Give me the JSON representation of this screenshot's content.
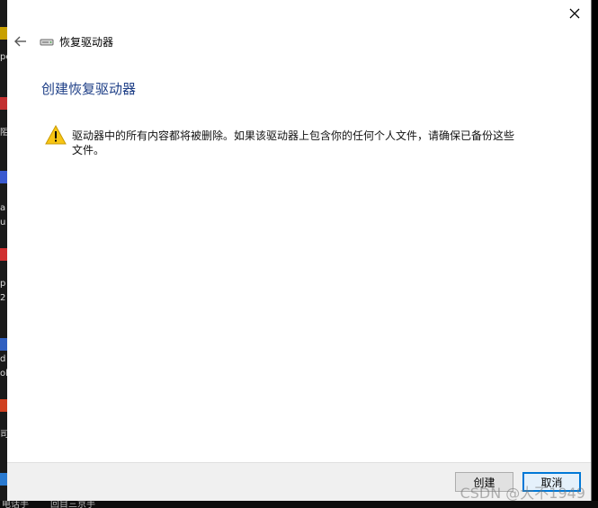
{
  "dialog": {
    "window_title": "恢复驱动器",
    "heading": "创建恢复驱动器",
    "warning_message": "驱动器中的所有内容都将被删除。如果该驱动器上包含你的任何个人文件，请确保已备份这些文件。",
    "buttons": {
      "create_label": "创建",
      "cancel_label": "取消"
    },
    "icons": {
      "back": "back-arrow-icon",
      "close": "close-icon",
      "drive": "drive-icon",
      "warning": "warning-icon"
    },
    "colors": {
      "heading": "#1e3f87",
      "cancel_border": "#0078d7",
      "warning_fill": "#f8c514"
    }
  },
  "desktop": {
    "left_fragments": [
      "pe",
      "阻",
      "a",
      "u",
      "p",
      "2",
      "d",
      "ol",
      "司"
    ],
    "bottom_fragments": [
      "电话手",
      "回目三京手"
    ]
  },
  "watermark": "CSDN @大不1949"
}
